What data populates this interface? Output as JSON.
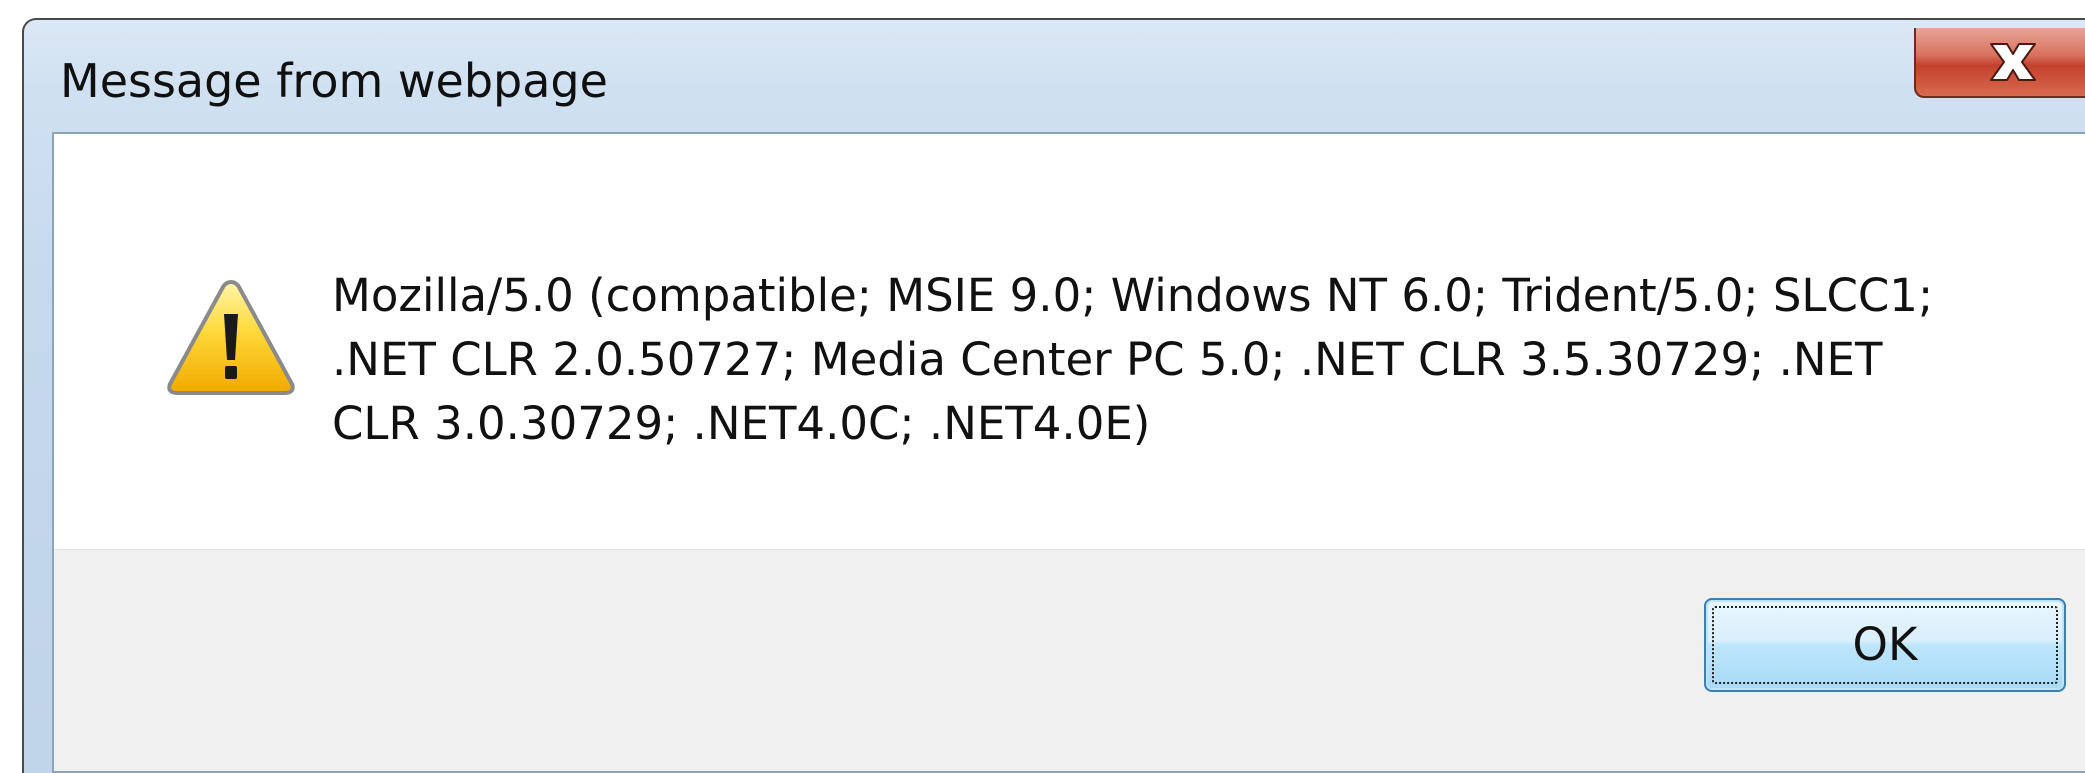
{
  "dialog": {
    "title": "Message from webpage",
    "close_icon": "close-x-icon",
    "close_accent": "#c7442f",
    "message_icon": "warning-icon",
    "message": "Mozilla/5.0 (compatible; MSIE 9.0; Windows NT 6.0; Trident/5.0; SLCC1; .NET CLR 2.0.50727; Media Center PC 5.0; .NET CLR 3.5.30729; .NET CLR 3.0.30729; .NET4.0C; .NET4.0E)",
    "ok_label": "OK"
  },
  "colors": {
    "title_bar": "#c5d8ec",
    "button_bar": "#f0f0f0",
    "ok_border": "#3c7fb1"
  }
}
